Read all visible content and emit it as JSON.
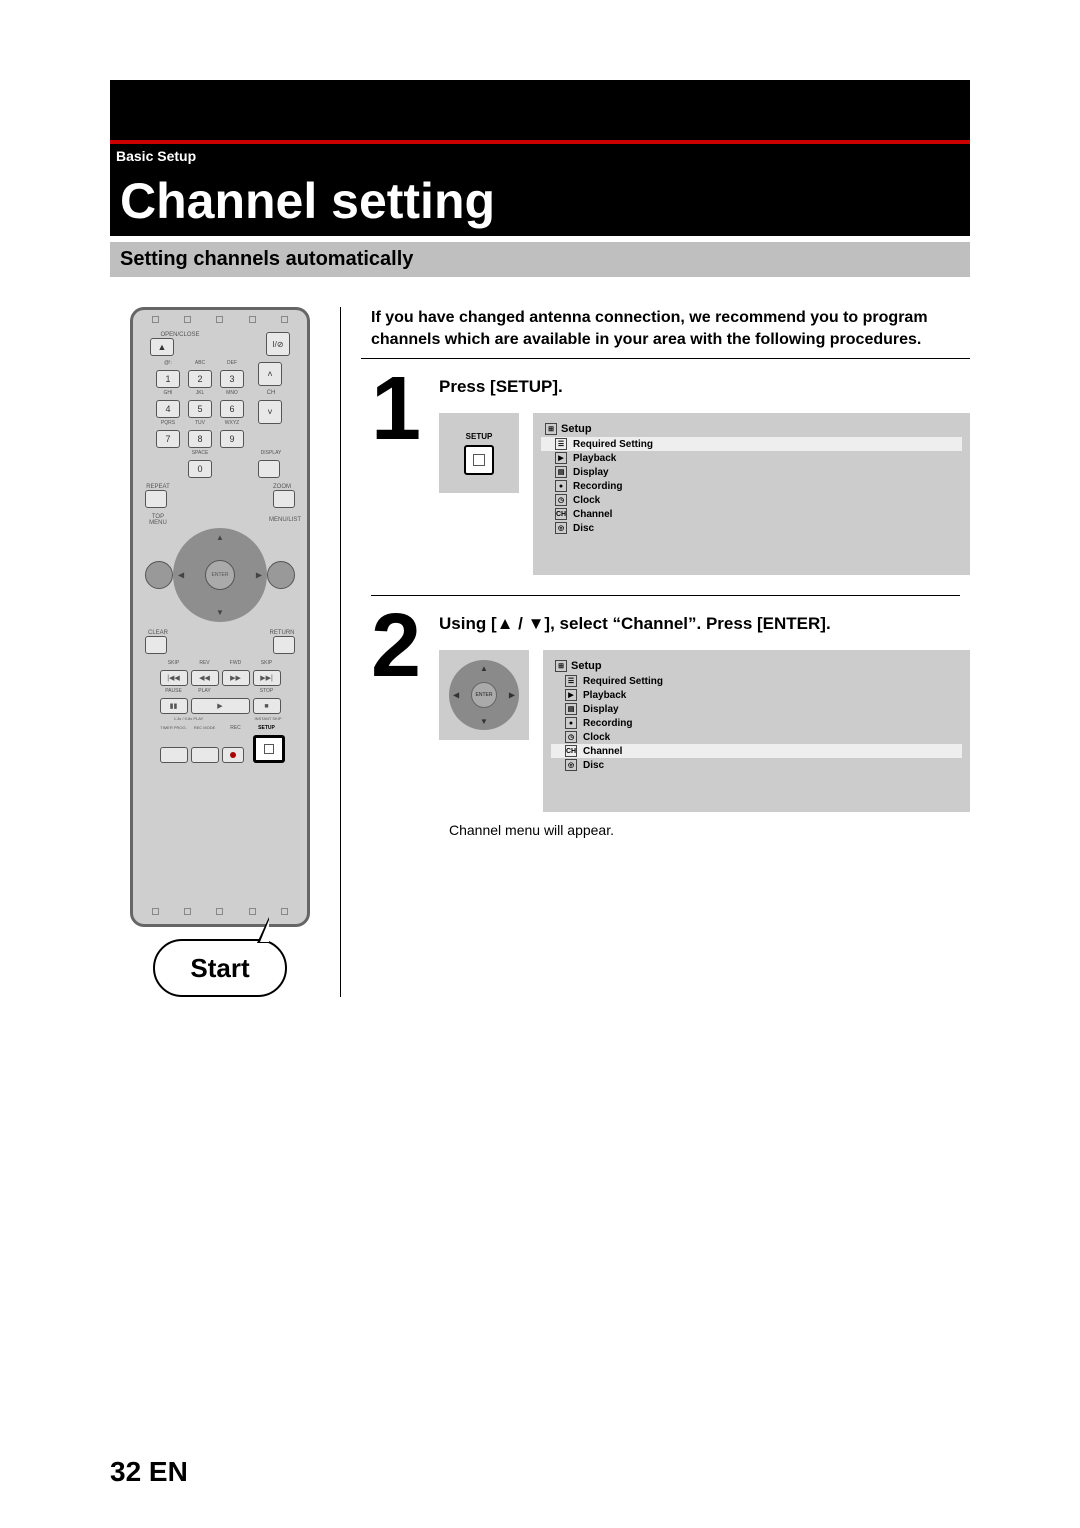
{
  "breadcrumb": "Basic Setup",
  "title": "Channel setting",
  "subtitle": "Setting channels automatically",
  "intro": "If you have changed antenna connection, we recommend you to program channels which are available in your area with the following procedures.",
  "step1": {
    "num": "1",
    "title": "Press [SETUP].",
    "btn_label": "SETUP"
  },
  "step2": {
    "num": "2",
    "title": "Using [▲ / ▼], select “Channel”. Press [ENTER].",
    "note": "Channel menu will appear.",
    "enter": "ENTER"
  },
  "menu": {
    "header": "Setup",
    "items": [
      "Required Setting",
      "Playback",
      "Display",
      "Recording",
      "Clock",
      "Channel",
      "Disc"
    ],
    "highlighted": "Channel"
  },
  "footer": "32  EN",
  "remote": {
    "open_close": "OPEN/CLOSE",
    "power": "I/⊘",
    "row1_lbl": [
      "@!:",
      "ABC",
      "DEF"
    ],
    "row1": [
      "1",
      "2",
      "3"
    ],
    "row2_lbl": [
      "GHI",
      "JKL",
      "MNO"
    ],
    "row2": [
      "4",
      "5",
      "6"
    ],
    "row3_lbl": [
      "PQRS",
      "TUV",
      "WXYZ"
    ],
    "row3": [
      "7",
      "8",
      "9"
    ],
    "space": "SPACE",
    "zero": "0",
    "display_lbl": "DISPLAY",
    "ch": "CH",
    "repeat": "REPEAT",
    "zoom": "ZOOM",
    "top_menu": "TOP MENU",
    "menu_list": "MENU/LIST",
    "enter": "ENTER",
    "clear": "CLEAR",
    "return": "RETURN",
    "trans_lbl": [
      "SKIP",
      "REV",
      "FWD",
      "SKIP"
    ],
    "trans_g": [
      "|◀◀",
      "◀◀",
      "▶▶",
      "▶▶|"
    ],
    "trans2_lbl": [
      "PAUSE",
      "PLAY",
      "",
      "STOP"
    ],
    "trans2_g": [
      "▮▮",
      "▶",
      "",
      "■"
    ],
    "speed": "1.3x / 0.8x PLAY",
    "instant": "INSTANT SKIP",
    "bot_lbl": [
      "TIMER PROG.",
      "REC MODE",
      "REC",
      "SETUP"
    ],
    "start": "Start"
  }
}
